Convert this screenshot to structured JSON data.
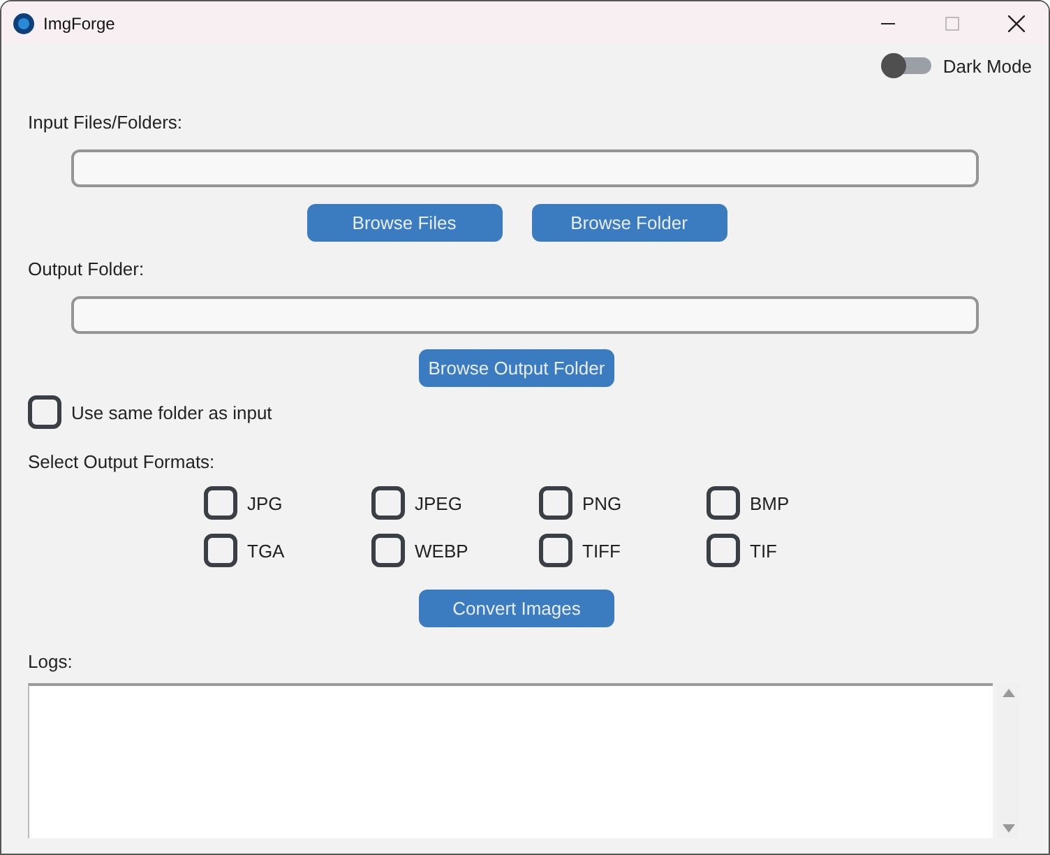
{
  "window": {
    "title": "ImgForge"
  },
  "dark_mode": {
    "label": "Dark Mode",
    "on": false
  },
  "input": {
    "label": "Input Files/Folders:",
    "buttons": [
      "Browse Files",
      "Browse Folder"
    ]
  },
  "output": {
    "label": "Output Folder:",
    "buttons": [
      "Browse Output Folder"
    ]
  },
  "same_folder": {
    "label": "Use same folder as input",
    "checked": false
  },
  "formats": {
    "label": "Select Output Formats:",
    "items": [
      {
        "label": "JPG",
        "checked": false
      },
      {
        "label": "JPEG",
        "checked": false
      },
      {
        "label": "PNG",
        "checked": false
      },
      {
        "label": "BMP",
        "checked": false
      },
      {
        "label": "TGA",
        "checked": false
      },
      {
        "label": "WEBP",
        "checked": false
      },
      {
        "label": "TIFF",
        "checked": false
      },
      {
        "label": "TIF",
        "checked": false
      }
    ]
  },
  "convert_button": "Convert Images",
  "logs": {
    "label": "Logs:"
  }
}
